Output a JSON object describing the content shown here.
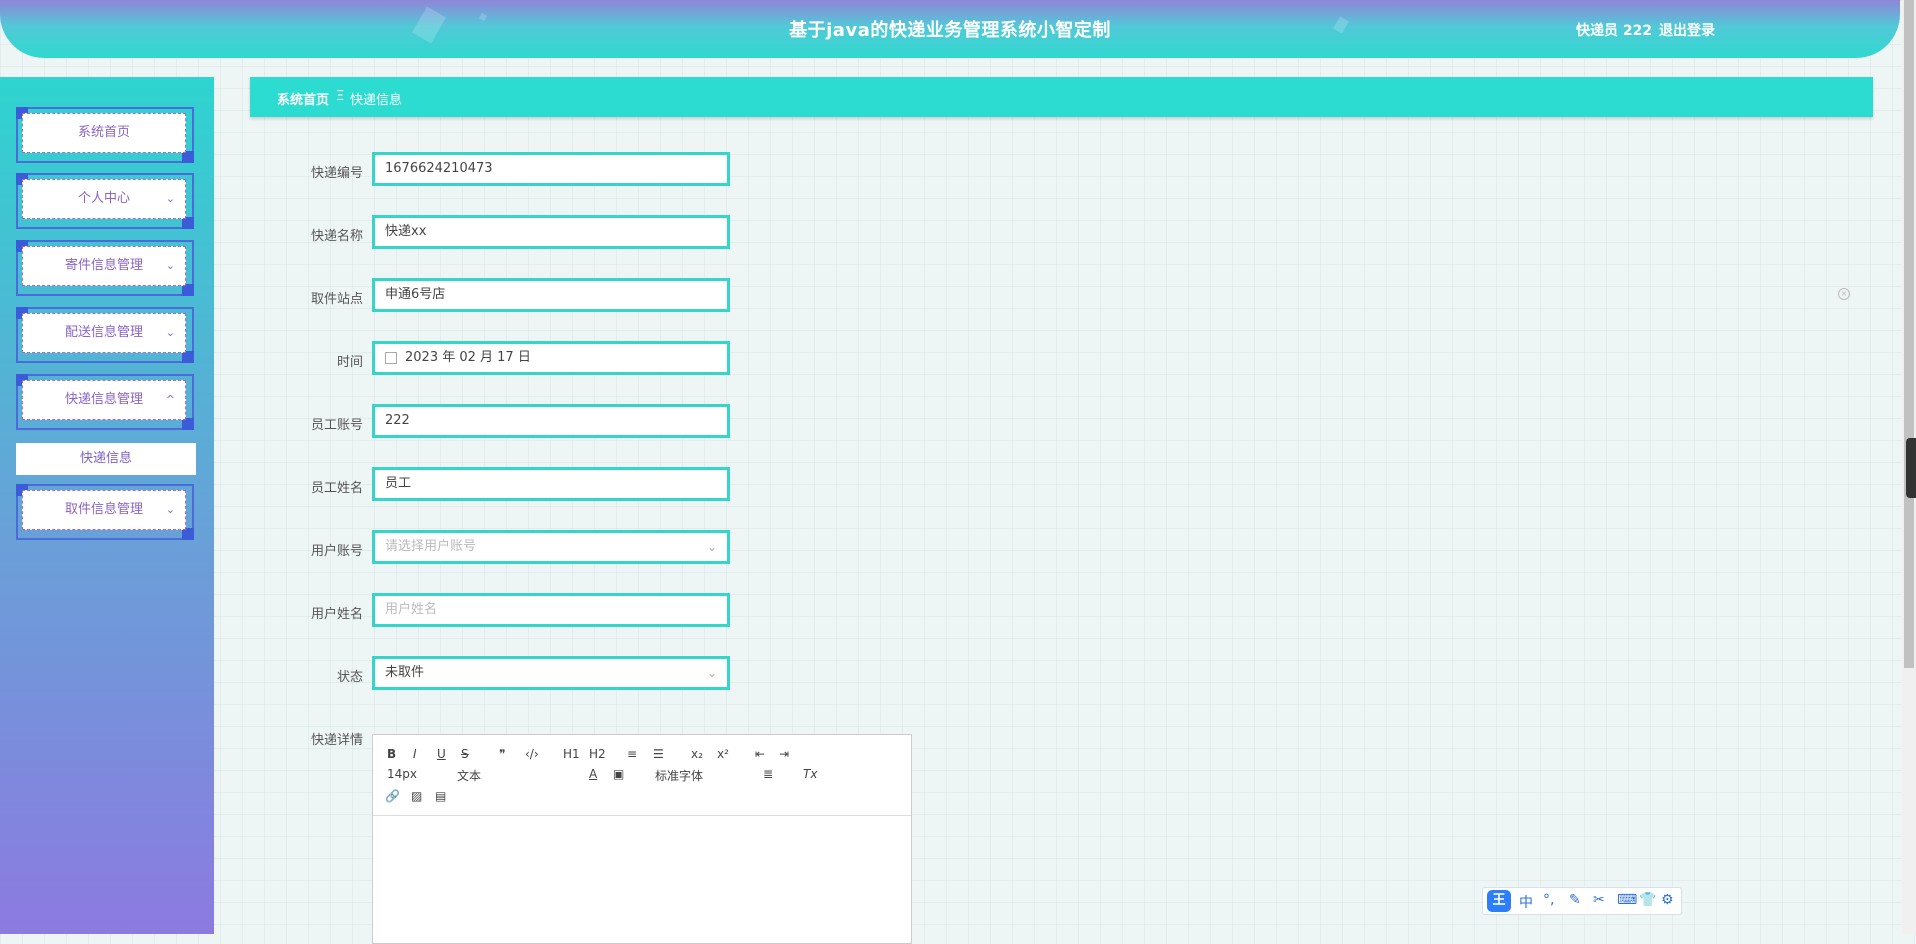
{
  "header": {
    "title": "基于java的快递业务管理系统小智定制",
    "user_label": "快递员 222",
    "logout_label": "退出登录"
  },
  "sidebar": {
    "items": [
      {
        "label": "系统首页",
        "has_chevron": false
      },
      {
        "label": "个人中心",
        "has_chevron": true
      },
      {
        "label": "寄件信息管理",
        "has_chevron": true
      },
      {
        "label": "配送信息管理",
        "has_chevron": true
      },
      {
        "label": "快递信息管理",
        "has_chevron": true
      },
      {
        "label": "取件信息管理",
        "has_chevron": true
      }
    ],
    "submenu_label": "快递信息",
    "chevron_down": "⌄",
    "chevron_up": "^"
  },
  "breadcrumb": {
    "home": "系统首页",
    "separator": "Ξ",
    "current": "快递信息"
  },
  "form": {
    "fields": [
      {
        "label": "快递编号",
        "value": "1676624210473"
      },
      {
        "label": "快递名称",
        "value": "快递xx"
      },
      {
        "label": "取件站点",
        "value": "申通6号店"
      },
      {
        "label": "时间",
        "value": "2023 年 02 月 17 日"
      },
      {
        "label": "员工账号",
        "value": "222"
      },
      {
        "label": "员工姓名",
        "value": "员工"
      },
      {
        "label": "用户账号",
        "placeholder": "请选择用户账号"
      },
      {
        "label": "用户姓名",
        "placeholder": "用户姓名"
      },
      {
        "label": "状态",
        "value": "未取件"
      }
    ],
    "detail_label": "快递详情"
  },
  "editor": {
    "font_size": "14px",
    "block_type": "文本",
    "font_family": "标准字体",
    "buttons": [
      "B",
      "I",
      "U",
      "S",
      "❞",
      "‹/›",
      "H1",
      "H2",
      "≡",
      "☰",
      "x₂",
      "x²",
      "⇤",
      "⇥",
      "A",
      "▣",
      "≣",
      "Tx",
      "🔗",
      "▨",
      "▤"
    ]
  },
  "ime": {
    "logo": "王",
    "glyphs": [
      "中",
      "°,",
      "✎",
      "✂",
      "⌨",
      "👕",
      "⚙"
    ]
  }
}
